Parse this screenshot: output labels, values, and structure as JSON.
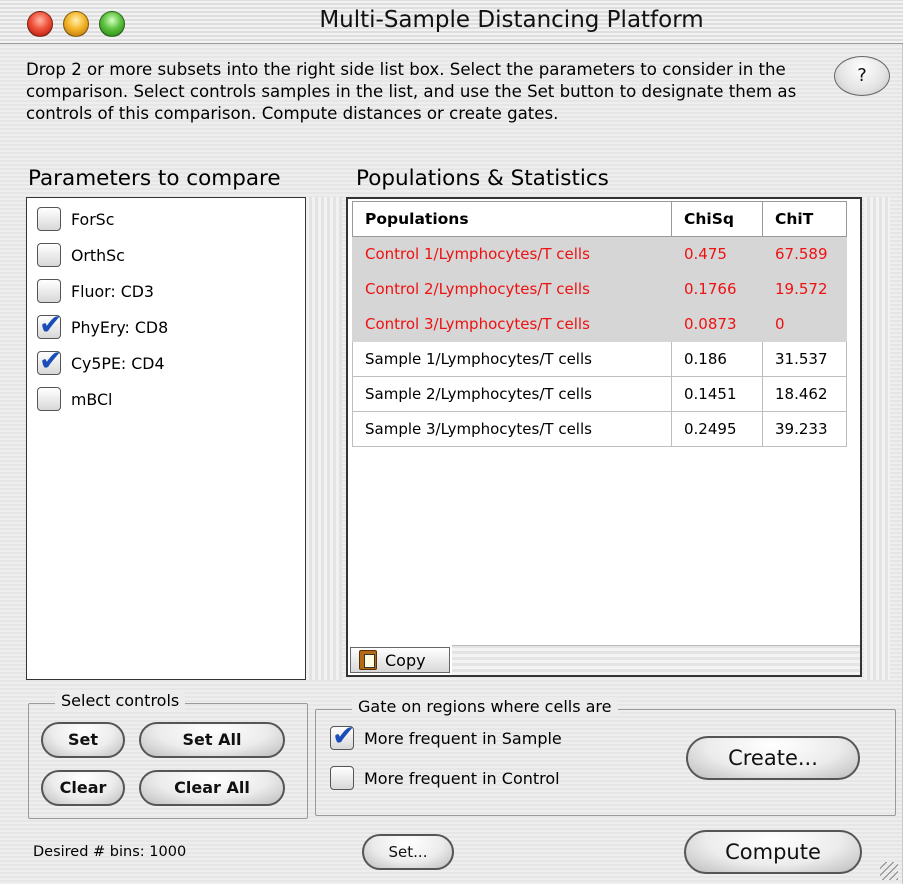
{
  "window": {
    "title": "Multi-Sample Distancing Platform"
  },
  "description": "Drop 2 or more subsets into the right side list box.  Select the parameters to consider in the comparison.  Select controls samples in the list, and use the Set button to designate them as controls of this comparison.  Compute distances or create gates.",
  "help_label": "?",
  "params": {
    "heading": "Parameters to compare",
    "items": [
      {
        "label": "ForSc",
        "checked": false
      },
      {
        "label": "OrthSc",
        "checked": false
      },
      {
        "label": "Fluor: CD3",
        "checked": false
      },
      {
        "label": "PhyEry: CD8",
        "checked": true
      },
      {
        "label": "Cy5PE: CD4",
        "checked": true
      },
      {
        "label": "mBCl",
        "checked": false
      }
    ]
  },
  "populations": {
    "heading": "Populations & Statistics",
    "columns": [
      "Populations",
      "ChiSq",
      "ChiT"
    ],
    "rows": [
      {
        "name": "Control 1/Lymphocytes/T cells",
        "chisq": "0.475",
        "chit": "67.589",
        "control": true
      },
      {
        "name": "Control 2/Lymphocytes/T cells",
        "chisq": "0.1766",
        "chit": "19.572",
        "control": true
      },
      {
        "name": "Control 3/Lymphocytes/T cells",
        "chisq": "0.0873",
        "chit": "0",
        "control": true
      },
      {
        "name": "Sample 1/Lymphocytes/T cells",
        "chisq": "0.186",
        "chit": "31.537",
        "control": false
      },
      {
        "name": "Sample 2/Lymphocytes/T cells",
        "chisq": "0.1451",
        "chit": "18.462",
        "control": false
      },
      {
        "name": "Sample 3/Lymphocytes/T cells",
        "chisq": "0.2495",
        "chit": "39.233",
        "control": false
      }
    ],
    "copy_label": "Copy"
  },
  "select_controls": {
    "label": "Select controls",
    "set": "Set",
    "set_all": "Set All",
    "clear": "Clear",
    "clear_all": "Clear All"
  },
  "gate": {
    "label": "Gate on regions where cells are",
    "opt_sample": {
      "label": "More frequent in Sample",
      "checked": true
    },
    "opt_control": {
      "label": "More frequent in Control",
      "checked": false
    },
    "create": "Create..."
  },
  "footer": {
    "bins_label": "Desired # bins: 1000",
    "set_bins": "Set...",
    "compute": "Compute"
  },
  "colors": {
    "control_text": "#ee1111",
    "control_bg": "#d6d6d6",
    "checkmark": "#1a4db8"
  }
}
